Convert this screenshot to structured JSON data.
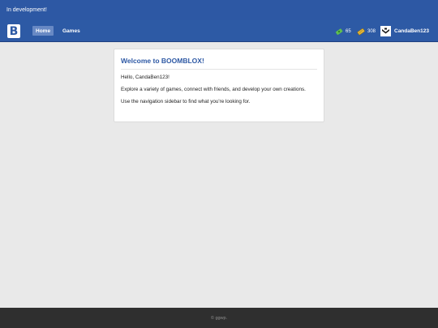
{
  "dev_banner": {
    "text": "In development!"
  },
  "nav": {
    "logo_letter": "B",
    "links": [
      {
        "label": "Home",
        "active": true
      },
      {
        "label": "Games",
        "active": false
      }
    ],
    "currencies": [
      {
        "icon": "green-cash-icon",
        "value": "65",
        "color": "#5fbf4f"
      },
      {
        "icon": "yellow-ticket-icon",
        "value": "308",
        "color": "#e3b63a"
      }
    ],
    "user": {
      "name": "CandaBen123",
      "avatar_icon": "user-avatar-icon"
    }
  },
  "card": {
    "title": "Welcome to BOOMBLOX!",
    "greeting": "Hello, CandaBen123!",
    "line1": "Explore a variety of games, connect with friends, and develop your own creations.",
    "line2": "Use the navigation sidebar to find what you're looking for."
  },
  "footer": {
    "text": "© ggwp."
  },
  "colors": {
    "brand_blue": "#2d5aa5",
    "active_link": "#6889c4",
    "background": "#e9e9e9",
    "footer": "#2f2f2f"
  }
}
